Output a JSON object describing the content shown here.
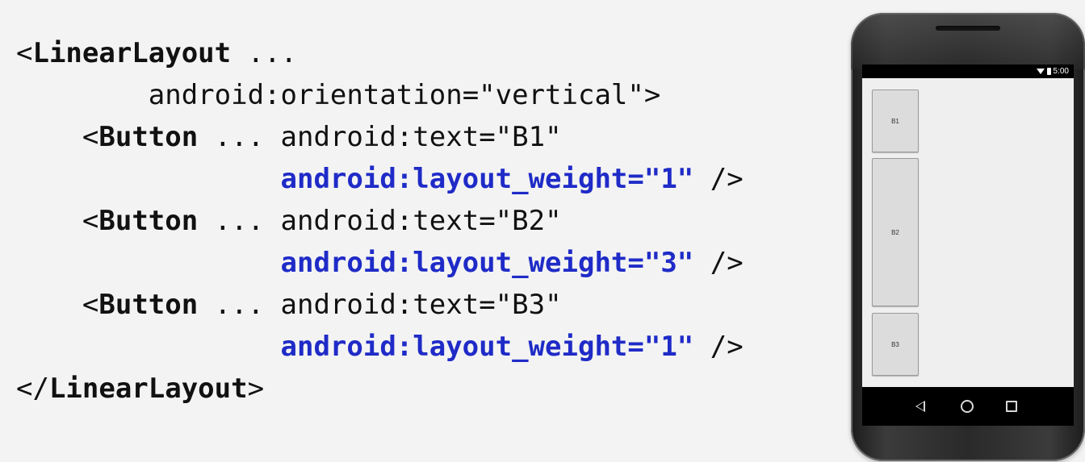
{
  "code": {
    "lines": [
      {
        "indent": "",
        "parts": [
          {
            "t": "<",
            "s": "plain"
          },
          {
            "t": "LinearLayout",
            "s": "kw"
          },
          {
            "t": " ...",
            "s": "plain"
          }
        ]
      },
      {
        "indent": "        ",
        "parts": [
          {
            "t": "android:orientation=\"vertical\">",
            "s": "plain"
          }
        ]
      },
      {
        "indent": "    ",
        "parts": [
          {
            "t": "<",
            "s": "plain"
          },
          {
            "t": "Button",
            "s": "kw"
          },
          {
            "t": " ... android:text=\"B1\"",
            "s": "plain"
          }
        ]
      },
      {
        "indent": "                ",
        "parts": [
          {
            "t": "android:layout_weight=\"1\"",
            "s": "hl"
          },
          {
            "t": " />",
            "s": "plain"
          }
        ]
      },
      {
        "indent": "    ",
        "parts": [
          {
            "t": "<",
            "s": "plain"
          },
          {
            "t": "Button",
            "s": "kw"
          },
          {
            "t": " ... android:text=\"B2\"",
            "s": "plain"
          }
        ]
      },
      {
        "indent": "                ",
        "parts": [
          {
            "t": "android:layout_weight=\"3\"",
            "s": "hl"
          },
          {
            "t": " />",
            "s": "plain"
          }
        ]
      },
      {
        "indent": "    ",
        "parts": [
          {
            "t": "<",
            "s": "plain"
          },
          {
            "t": "Button",
            "s": "kw"
          },
          {
            "t": " ... android:text=\"B3\"",
            "s": "plain"
          }
        ]
      },
      {
        "indent": "                ",
        "parts": [
          {
            "t": "android:layout_weight=\"1\"",
            "s": "hl"
          },
          {
            "t": " />",
            "s": "plain"
          }
        ]
      },
      {
        "indent": "",
        "parts": [
          {
            "t": "</",
            "s": "plain"
          },
          {
            "t": "LinearLayout",
            "s": "kw"
          },
          {
            "t": ">",
            "s": "plain"
          }
        ]
      }
    ],
    "highlight_color": "#1f2bc7",
    "text_color": "#111111"
  },
  "phone": {
    "status_time": "5:00",
    "status_icons": [
      "wifi-icon",
      "battery-icon"
    ],
    "buttons": [
      {
        "label": "B1",
        "weight": 1
      },
      {
        "label": "B2",
        "weight": 3
      },
      {
        "label": "B3",
        "weight": 1
      }
    ],
    "nav_icons": [
      "back-icon",
      "home-icon",
      "recents-icon"
    ]
  }
}
